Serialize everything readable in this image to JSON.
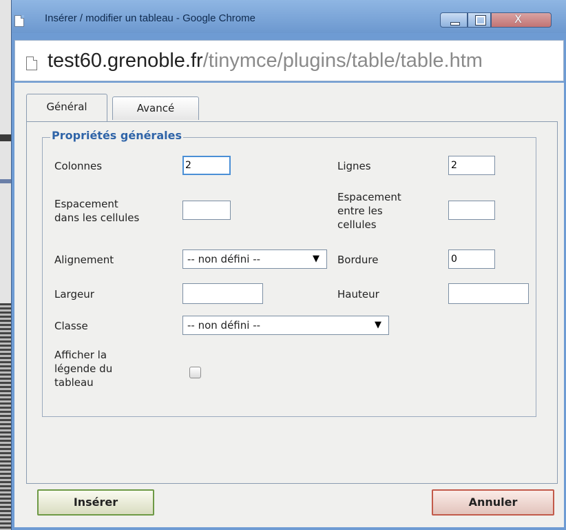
{
  "window": {
    "title": "Insérer / modifier un tableau - Google Chrome",
    "close_glyph": "X"
  },
  "address": {
    "host": "test60.grenoble.fr",
    "path": "/tinymce/plugins/table/table.htm"
  },
  "tabs": [
    {
      "label": "Général",
      "active": true
    },
    {
      "label": "Avancé",
      "active": false
    }
  ],
  "fieldset": {
    "legend": "Propriétés générales"
  },
  "fields": {
    "colonnes": {
      "label": "Colonnes",
      "value": "2"
    },
    "lignes": {
      "label": "Lignes",
      "value": "2"
    },
    "cellpadding": {
      "label_line1": "Espacement",
      "label_line2": "dans les cellules",
      "value": ""
    },
    "cellspacing": {
      "label_line1": "Espacement",
      "label_line2": "entre les",
      "label_line3": "cellules",
      "value": ""
    },
    "alignement": {
      "label": "Alignement",
      "selected": "-- non défini --"
    },
    "bordure": {
      "label": "Bordure",
      "value": "0"
    },
    "largeur": {
      "label": "Largeur",
      "value": ""
    },
    "hauteur": {
      "label": "Hauteur",
      "value": ""
    },
    "classe": {
      "label": "Classe",
      "selected": "-- non défini --"
    },
    "caption": {
      "label_line1": "Afficher la",
      "label_line2": "légende du",
      "label_line3": "tableau",
      "checked": false
    }
  },
  "buttons": {
    "insert": "Insérer",
    "cancel": "Annuler"
  },
  "icons": {
    "select_arrow": "▼"
  },
  "colors": {
    "legend": "#2f64a8",
    "titlebar": "#6e9bd3",
    "insert_border": "#6d9945",
    "cancel_border": "#c25a4a"
  }
}
